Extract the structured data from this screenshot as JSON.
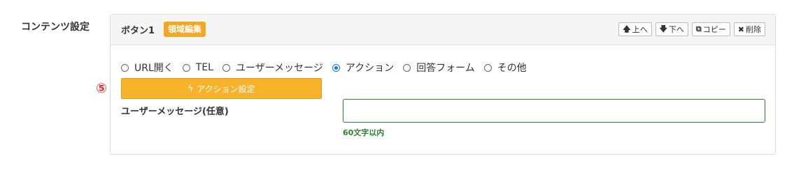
{
  "section": {
    "label": "コンテンツ設定"
  },
  "panel": {
    "title": "ボタン1",
    "badge": "領域編集",
    "buttons": [
      {
        "icon": "arrow-up-icon",
        "glyph": "🡅",
        "label": "上へ"
      },
      {
        "icon": "arrow-down-icon",
        "glyph": "🡇",
        "label": "下へ"
      },
      {
        "icon": "copy-icon",
        "glyph": "⧉",
        "label": "コピー"
      },
      {
        "icon": "close-icon",
        "glyph": "✖",
        "label": "削除"
      }
    ]
  },
  "radio_options": [
    {
      "label": "URL開く",
      "checked": false
    },
    {
      "label": "TEL",
      "checked": false
    },
    {
      "label": "ユーザーメッセージ",
      "checked": false
    },
    {
      "label": "アクション",
      "checked": true
    },
    {
      "label": "回答フォーム",
      "checked": false
    },
    {
      "label": "その他",
      "checked": false
    }
  ],
  "step_marker": "⑤",
  "action_button": {
    "icon": "bolt-icon",
    "glyph": "ϟ",
    "label": "アクション設定"
  },
  "user_message": {
    "label": "ユーザーメッセージ(任意)",
    "value": "",
    "hint": "60文字以内"
  },
  "colors": {
    "accent_orange": "#f7b32b",
    "badge_orange": "#f5a623",
    "radio_blue": "#1a73e8",
    "hint_green": "#2e7d32",
    "step_red": "#e53935"
  }
}
